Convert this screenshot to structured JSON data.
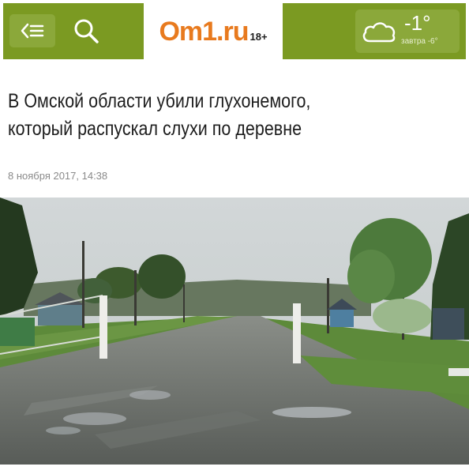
{
  "header": {
    "logo": {
      "text": "Om1.ru",
      "age_rating": "18+"
    },
    "menu_icon": "menu-back-icon",
    "search_icon": "search-icon",
    "weather": {
      "icon": "cloud-icon",
      "temperature": "-1°",
      "tomorrow": "завтра -6°"
    }
  },
  "article": {
    "title_line1": "В Омской области убили глухонемого,",
    "title_line2": "который распускал слухи по деревне",
    "date": "8 ноября 2017, 14:38"
  },
  "colors": {
    "header_green": "#7b9a22",
    "logo_orange": "#e87a1e"
  }
}
